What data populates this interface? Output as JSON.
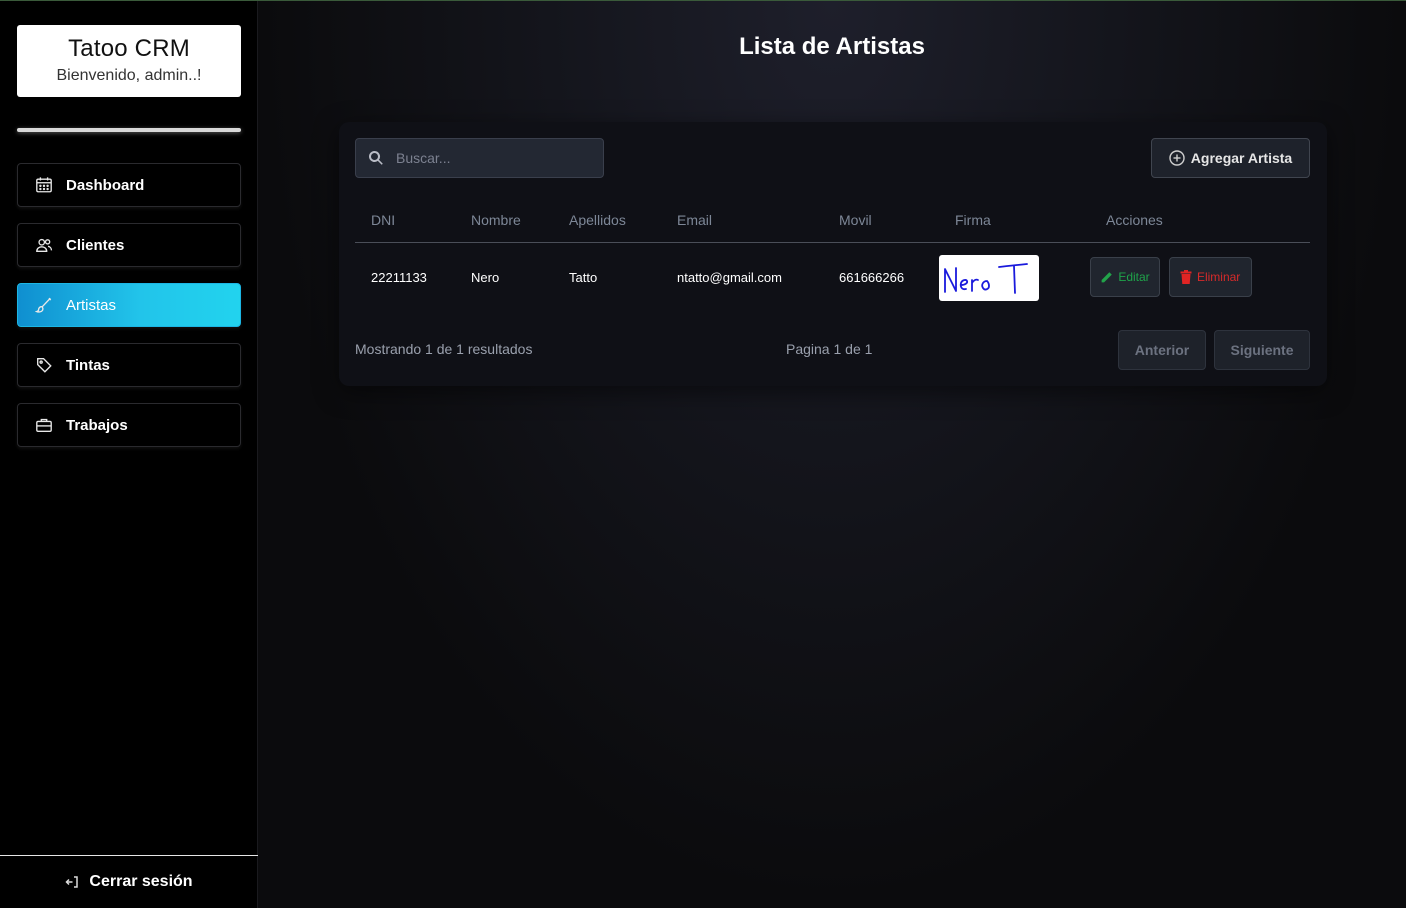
{
  "sidebar": {
    "brand_title": "Tatoo CRM",
    "brand_subtitle": "Bienvenido, admin..!",
    "items": [
      {
        "label": "Dashboard",
        "icon": "calendar-icon",
        "active": false
      },
      {
        "label": "Clientes",
        "icon": "users-icon",
        "active": false
      },
      {
        "label": "Artistas",
        "icon": "brush-icon",
        "active": true
      },
      {
        "label": "Tintas",
        "icon": "tag-icon",
        "active": false
      },
      {
        "label": "Trabajos",
        "icon": "briefcase-icon",
        "active": false
      }
    ],
    "logout_label": "Cerrar sesión"
  },
  "main": {
    "title": "Lista de Artistas",
    "search": {
      "placeholder": "Buscar...",
      "value": ""
    },
    "add_button_label": "Agregar Artista",
    "table": {
      "columns": [
        "DNI",
        "Nombre",
        "Apellidos",
        "Email",
        "Movil",
        "Firma",
        "Acciones"
      ],
      "rows": [
        {
          "dni": "22211133",
          "nombre": "Nero",
          "apellidos": "Tatto",
          "email": "ntatto@gmail.com",
          "movil": "661666266",
          "firma": "Nero T",
          "edit_label": "Editar",
          "delete_label": "Eliminar"
        }
      ]
    },
    "pagination": {
      "summary": "Mostrando 1 de 1 resultados",
      "page_info": "Pagina 1 de 1",
      "prev_label": "Anterior",
      "next_label": "Siguiente"
    }
  },
  "colors": {
    "accent_active": "#22d3ee",
    "edit": "#22a34a",
    "delete": "#e02424",
    "signature_ink": "#1a1adc"
  }
}
